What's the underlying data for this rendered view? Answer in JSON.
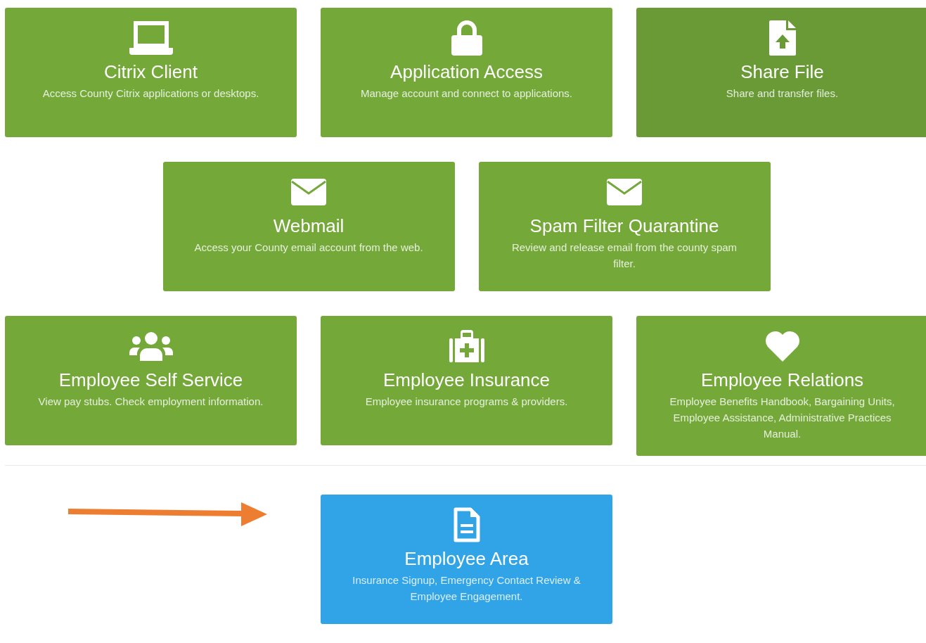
{
  "tile_rows": [
    {
      "tiles": [
        {
          "kind": "laptop",
          "title": "Citrix Client",
          "description": "Access County Citrix applications or desktops.",
          "color": "#74a838"
        },
        {
          "kind": "lock",
          "title": "Application Access",
          "description": "Manage account and connect to applications.",
          "color": "#74a838"
        },
        {
          "kind": "file-upload",
          "title": "Share File",
          "description": "Share and transfer files.",
          "color": "#699a36"
        }
      ]
    },
    {
      "tiles": [
        {
          "kind": "envelope",
          "title": "Webmail",
          "description": "Access your County email account from the web.",
          "color": "#74a838"
        },
        {
          "kind": "envelope",
          "title": "Spam Filter Quarantine",
          "description": "Review and release email from the county spam filter.",
          "color": "#74a838"
        }
      ]
    },
    {
      "tiles": [
        {
          "kind": "users",
          "title": "Employee Self Service",
          "description": "View pay stubs. Check employment information.",
          "color": "#74a838"
        },
        {
          "kind": "medkit",
          "title": "Employee Insurance",
          "description": "Employee insurance programs & providers.",
          "color": "#74a838"
        },
        {
          "kind": "heart",
          "title": "Employee Relations",
          "description": "Employee Benefits Handbook, Bargaining Units, Employee Assistance, Administrative Practices Manual.",
          "color": "#74a838"
        }
      ]
    }
  ],
  "featured_tile": {
    "kind": "file-text",
    "title": "Employee Area",
    "description": "Insurance Signup, Emergency Contact Review & Employee Engagement.",
    "color": "#30a4e6"
  },
  "annotation_arrow": {
    "color": "#ed7d31"
  }
}
